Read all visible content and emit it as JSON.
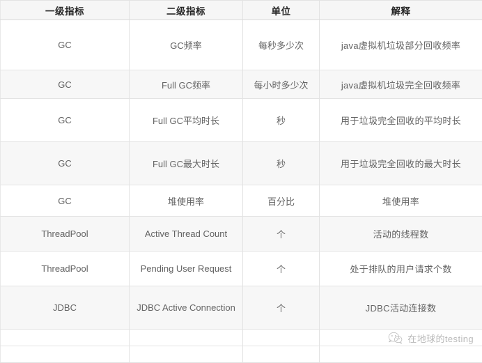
{
  "table": {
    "headers": [
      {
        "label": "一级指标",
        "key": "primary"
      },
      {
        "label": "二级指标",
        "key": "secondary"
      },
      {
        "label": "单位",
        "key": "unit"
      },
      {
        "label": "解释",
        "key": "desc"
      }
    ],
    "rows": [
      {
        "primary": "GC",
        "secondary": "GC频率",
        "unit": "每秒多少次",
        "desc": "java虚拟机垃圾部分回收频率"
      },
      {
        "primary": "GC",
        "secondary": "Full GC频率",
        "unit": "每小时多少次",
        "desc": "java虚拟机垃圾完全回收频率"
      },
      {
        "primary": "GC",
        "secondary": "Full GC平均时长",
        "unit": "秒",
        "desc": "用于垃圾完全回收的平均时长"
      },
      {
        "primary": "GC",
        "secondary": "Full GC最大时长",
        "unit": "秒",
        "desc": "用于垃圾完全回收的最大时长"
      },
      {
        "primary": "GC",
        "secondary": "堆使用率",
        "unit": "百分比",
        "desc": "堆使用率"
      },
      {
        "primary": "ThreadPool",
        "secondary": "Active Thread Count",
        "unit": "个",
        "desc": "活动的线程数"
      },
      {
        "primary": "ThreadPool",
        "secondary": "Pending User Request",
        "unit": "个",
        "desc": "处于排队的用户请求个数"
      },
      {
        "primary": "JDBC",
        "secondary": "JDBC Active Connection",
        "unit": "个",
        "desc": "JDBC活动连接数"
      },
      {
        "primary": "",
        "secondary": "",
        "unit": "",
        "desc": ""
      },
      {
        "primary": "",
        "secondary": "",
        "unit": "",
        "desc": ""
      }
    ]
  },
  "watermark": {
    "icon": "wechat-logo-icon",
    "text": "在地球的testing"
  },
  "colors": {
    "header_background": "#f6f6f6",
    "header_text": "#262626",
    "body_text": "#636363",
    "alt_row_background": "#f7f7f7",
    "border": "#e3e3e3",
    "page_background": "#ffffff",
    "watermark_text": "#8e8e8e"
  }
}
